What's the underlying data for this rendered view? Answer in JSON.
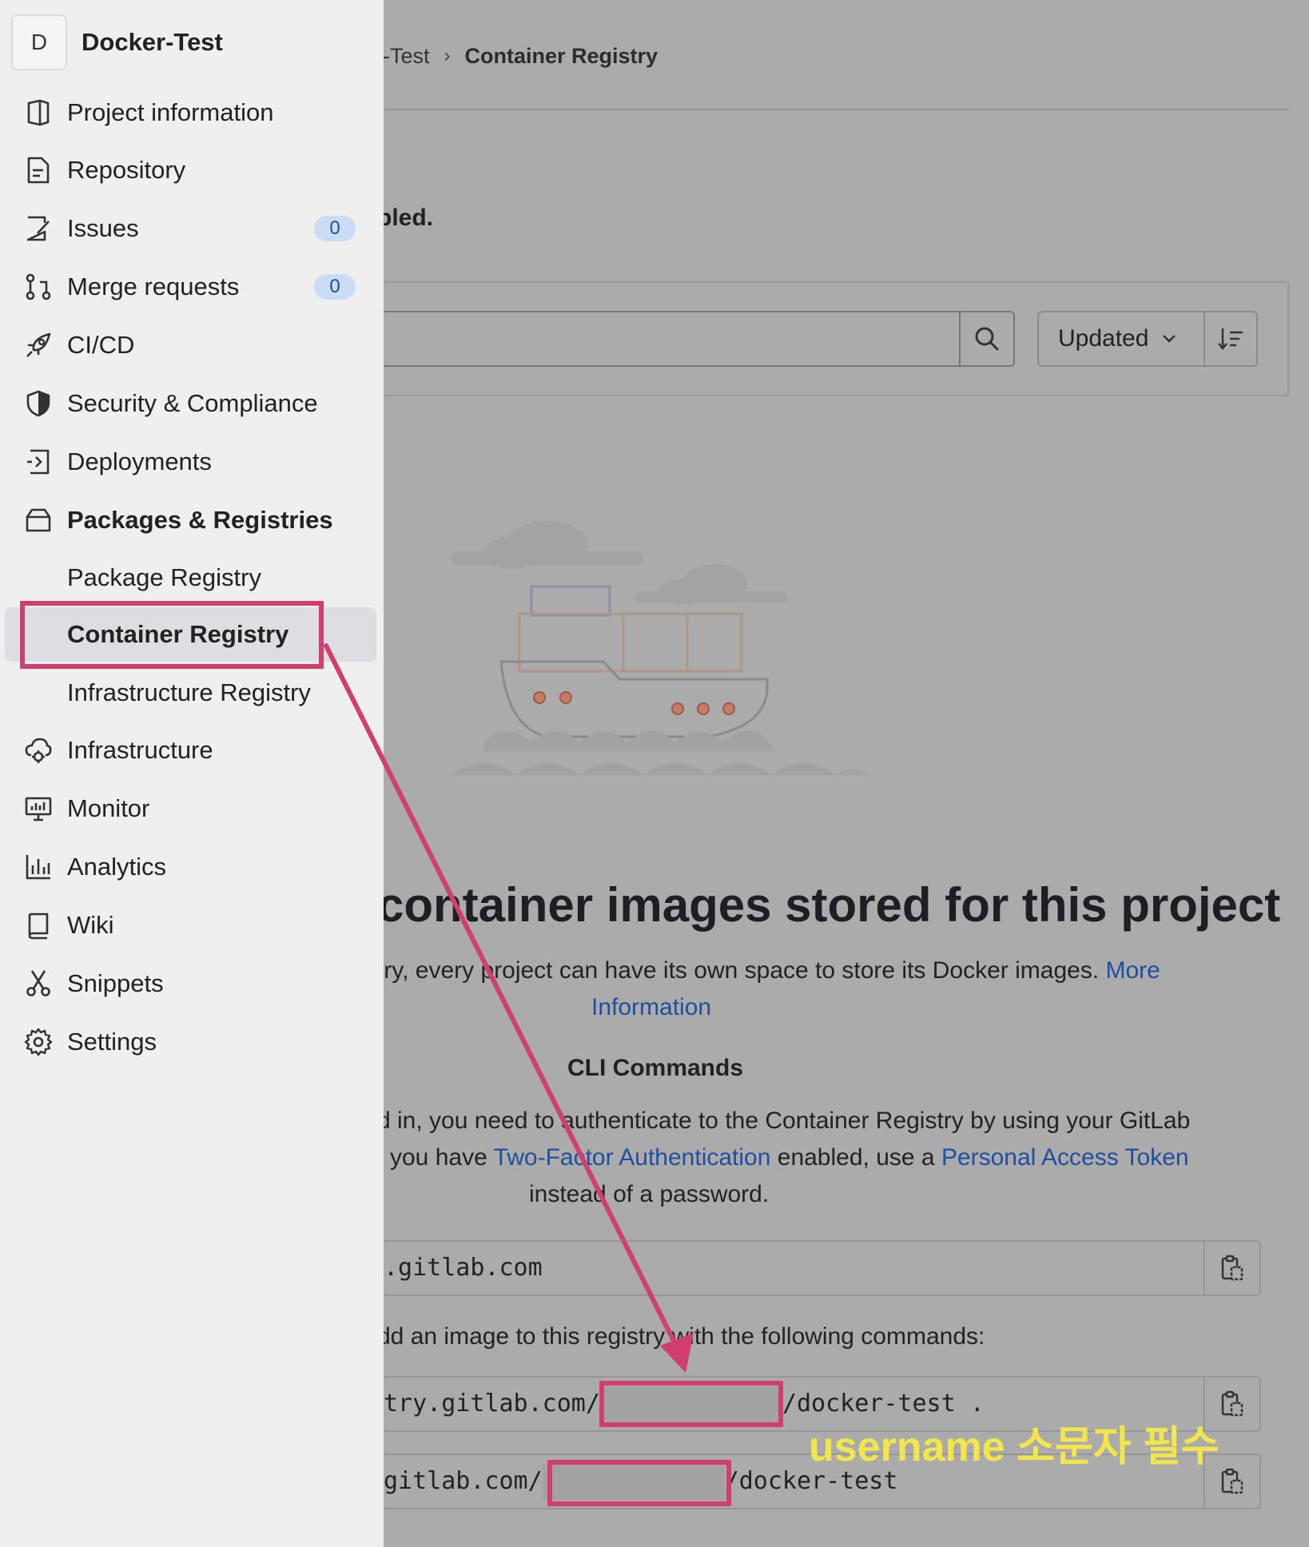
{
  "project": {
    "avatar_letter": "D",
    "name": "Docker-Test"
  },
  "sidebar": {
    "items": [
      {
        "label": "Project information"
      },
      {
        "label": "Repository"
      },
      {
        "label": "Issues",
        "badge": "0"
      },
      {
        "label": "Merge requests",
        "badge": "0"
      },
      {
        "label": "CI/CD"
      },
      {
        "label": "Security & Compliance"
      },
      {
        "label": "Deployments"
      },
      {
        "label": "Packages & Registries"
      },
      {
        "label": "Package Registry"
      },
      {
        "label": "Container Registry"
      },
      {
        "label": "Infrastructure Registry"
      },
      {
        "label": "Infrastructure"
      },
      {
        "label": "Monitor"
      },
      {
        "label": "Analytics"
      },
      {
        "label": "Wiki"
      },
      {
        "label": "Snippets"
      },
      {
        "label": "Settings"
      }
    ]
  },
  "breadcrumb": {
    "prev": "r-Test",
    "current": "Container Registry"
  },
  "notice": "bled.",
  "filter": {
    "sort_label": "Updated"
  },
  "empty_state": {
    "title": "container images stored for this project",
    "desc_part1": "try, every project can have its own space to store its Docker images. ",
    "desc_link1": "More",
    "desc_link2": "Information",
    "cli_title": "CLI Commands",
    "auth_line1": "d in, you need to authenticate to the Container Registry by using your GitLab",
    "auth_line2_pre": " you have ",
    "auth_link_2fa": "Two-Factor Authentication",
    "auth_line2_mid": " enabled, use a ",
    "auth_link_pat": "Personal Access Token",
    "auth_line3": "instead of a password.",
    "login_cmd": ".gitlab.com",
    "push_desc": "dd an image to this registry with the following commands:",
    "build_cmd_pre": "try.gitlab.com/",
    "build_cmd_post": "/docker-test .",
    "push_cmd_pre": "gitlab.com/",
    "push_cmd_post": "/docker-test"
  },
  "annotation": {
    "label": "username 소문자 필수",
    "color": "#d0406f",
    "label_color": "#f3e64d"
  }
}
